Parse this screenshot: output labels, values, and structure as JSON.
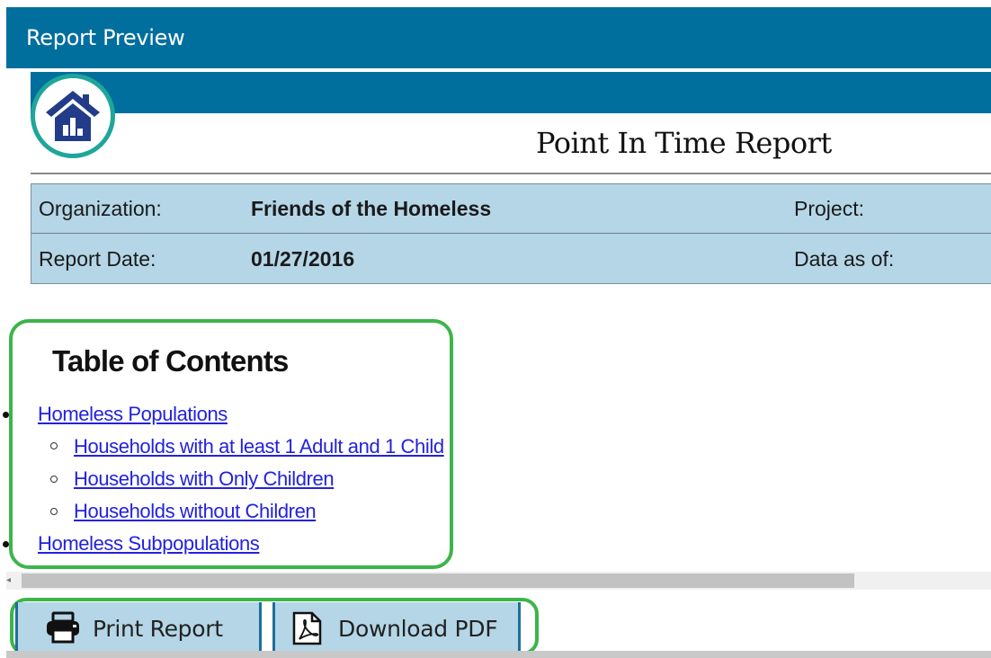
{
  "window": {
    "title": "Report Preview"
  },
  "report": {
    "title": "Point In Time Report",
    "info": {
      "organization_label": "Organization:",
      "organization_value": "Friends of the Homeless",
      "project_label": "Project:",
      "report_date_label": "Report Date:",
      "report_date_value": "01/27/2016",
      "data_as_of_label": "Data as of:"
    },
    "toc": {
      "heading": "Table of Contents",
      "items": [
        {
          "label": "Homeless Populations",
          "level": 1
        },
        {
          "label": "Households with at least 1 Adult and 1 Child",
          "level": 2
        },
        {
          "label": "Households with Only Children",
          "level": 2
        },
        {
          "label": "Households without Children",
          "level": 2
        },
        {
          "label": "Homeless Subpopulations",
          "level": 1
        }
      ]
    }
  },
  "actions": {
    "print_label": "Print Report",
    "download_label": "Download PDF"
  },
  "icons": {
    "logo": "house-chart-icon",
    "print": "printer-icon",
    "download": "pdf-file-icon",
    "scroll_left": "scroll-left-arrow-icon"
  },
  "colors": {
    "header_blue": "#006f9e",
    "table_bg": "#b4d6e7",
    "logo_ring": "#1fa69a",
    "highlight_green": "#3cb54a",
    "link": "#2222dd"
  }
}
